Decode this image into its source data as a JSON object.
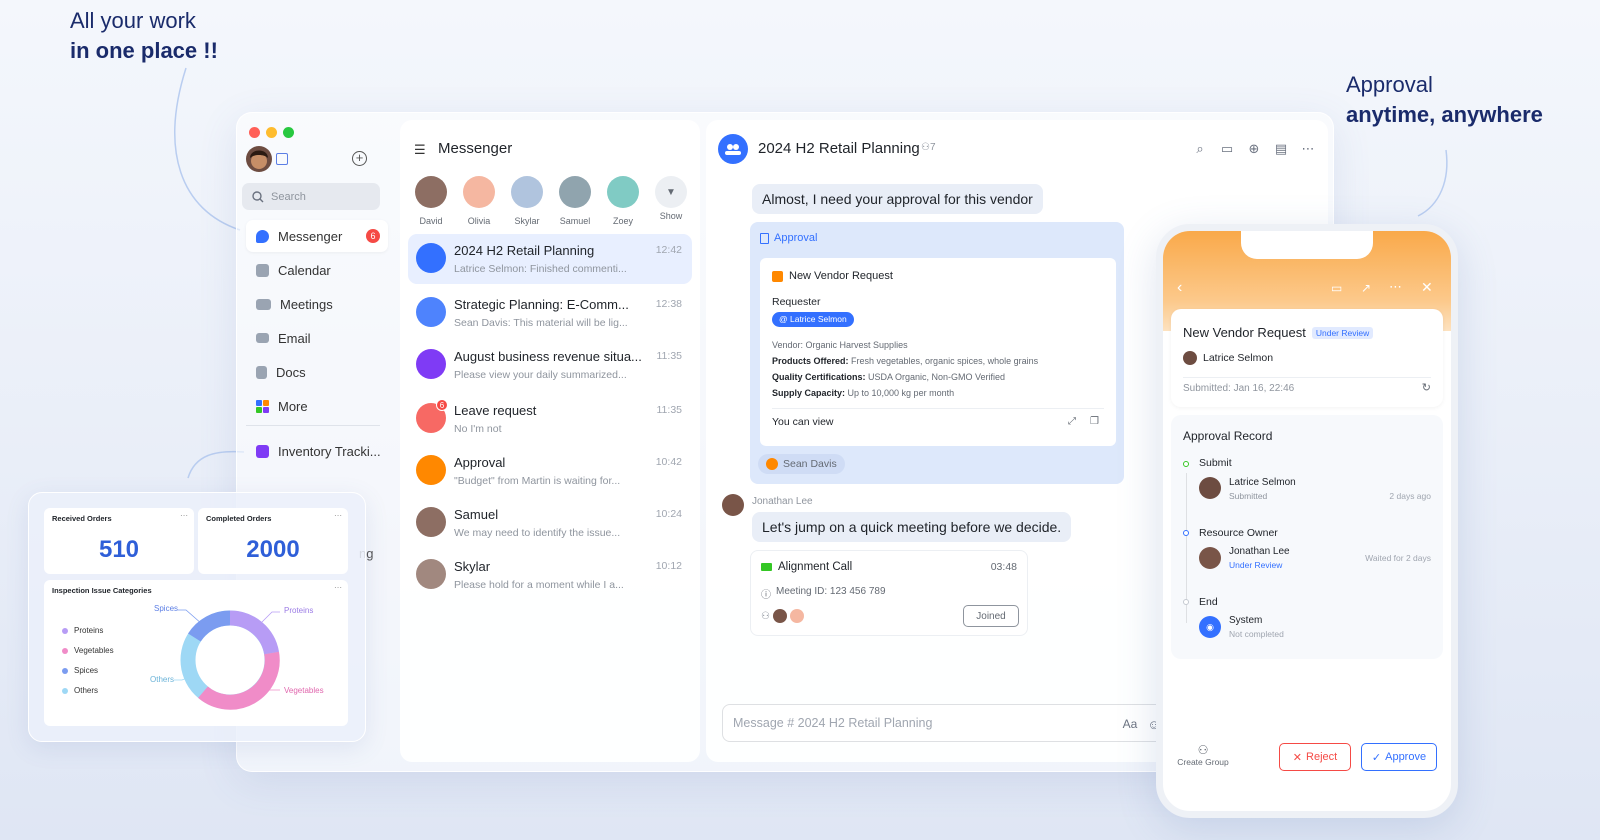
{
  "headlines": {
    "left_light": "All your work",
    "left_bold": "in one place !!",
    "right_light": "Approval",
    "right_bold": "anytime, anywhere"
  },
  "sidebar": {
    "search_placeholder": "Search",
    "items": [
      {
        "label": "Messenger",
        "badge": "6",
        "icon": "chat-icon",
        "active": true
      },
      {
        "label": "Calendar",
        "icon": "calendar-icon"
      },
      {
        "label": "Meetings",
        "icon": "video-icon"
      },
      {
        "label": "Email",
        "icon": "mail-icon"
      },
      {
        "label": "Docs",
        "icon": "doc-icon"
      },
      {
        "label": "More",
        "icon": "grid-icon"
      }
    ],
    "pinned_app": "Inventory Tracki...",
    "partial_text": "ng"
  },
  "messenger": {
    "title": "Messenger",
    "contacts": [
      "David",
      "Olivia",
      "Skylar",
      "Samuel",
      "Zoey"
    ],
    "show_label": "Show",
    "chats": [
      {
        "name": "2024 H2 Retail Planning",
        "preview": "Latrice Selmon: Finished commenti...",
        "time": "12:42",
        "color": "#3370ff"
      },
      {
        "name": "Strategic Planning: E-Comm...",
        "preview": "Sean Davis: This material will be lig...",
        "time": "12:38",
        "color": "#4e83fd"
      },
      {
        "name": "August business revenue situa...",
        "preview": "Please view your daily summarized...",
        "time": "11:35",
        "color": "#7f3bf5"
      },
      {
        "name": "Leave request",
        "preview": "No I'm not",
        "time": "11:35",
        "color": "#f76964",
        "badge": "6"
      },
      {
        "name": "Approval",
        "preview": "\"Budget\" from Martin is waiting for...",
        "time": "10:42",
        "color": "#ff8800"
      },
      {
        "name": "Samuel",
        "preview": "We may need to identify the issue...",
        "time": "10:24",
        "color": "#8d6e63"
      },
      {
        "name": "Skylar",
        "preview": "Please hold for a moment while I a...",
        "time": "10:12",
        "color": "#a1887f"
      }
    ]
  },
  "chat": {
    "title": "2024 H2 Retail Planning",
    "member_count": "7",
    "message1": "Almost, I need your approval for this vendor",
    "approval_label": "Approval",
    "card": {
      "title": "New Vendor Request",
      "requester_label": "Requester",
      "requester": "@ Latrice Selmon",
      "vendor": "Vendor: Organic Harvest Supplies",
      "products_label": "Products Offered:",
      "products": " Fresh vegetables, organic spices, whole grains",
      "quality_label": "Quality Certifications:",
      "quality": " USDA Organic, Non-GMO Verified",
      "supply_label": "Supply Capacity:",
      "supply": " Up to 10,000 kg per month",
      "footer": "You can view"
    },
    "reaction_user": "Sean Davis",
    "sender2": "Jonathan Lee",
    "message2": "Let's jump on a quick meeting before we decide.",
    "meeting": {
      "title": "Alignment Call",
      "duration": "03:48",
      "meeting_id": "Meeting ID: 123 456 789",
      "button": "Joined"
    },
    "input_placeholder": "Message # 2024 H2 Retail Planning"
  },
  "dashboard": {
    "received_label": "Received Orders",
    "received_value": "510",
    "completed_label": "Completed Orders",
    "completed_value": "2000",
    "donut_title": "Inspection Issue Categories",
    "legend": [
      {
        "label": "Proteins",
        "color": "#b79cf5"
      },
      {
        "label": "Vegetables",
        "color": "#f08cc8"
      },
      {
        "label": "Spices",
        "color": "#7b9cf0"
      },
      {
        "label": "Others",
        "color": "#9ed8f5"
      }
    ],
    "callouts": {
      "spices": "Spices",
      "proteins": "Proteins",
      "others": "Others",
      "vegetables": "Vegetables"
    }
  },
  "phone": {
    "title": "New Vendor Request",
    "status": "Under Review",
    "requester": "Latrice Selmon",
    "submitted": "Submitted: Jan 16, 22:46",
    "record_title": "Approval Record",
    "steps": [
      {
        "label": "Submit",
        "person": "Latrice Selmon",
        "state": "Submitted",
        "when": "2 days ago"
      },
      {
        "label": "Resource Owner",
        "person": "Jonathan Lee",
        "state": "Under Review",
        "when": "Waited for 2 days"
      },
      {
        "label": "End",
        "person": "System",
        "state": "Not completed",
        "when": ""
      }
    ],
    "create_group": "Create Group",
    "reject": "Reject",
    "approve": "Approve"
  }
}
